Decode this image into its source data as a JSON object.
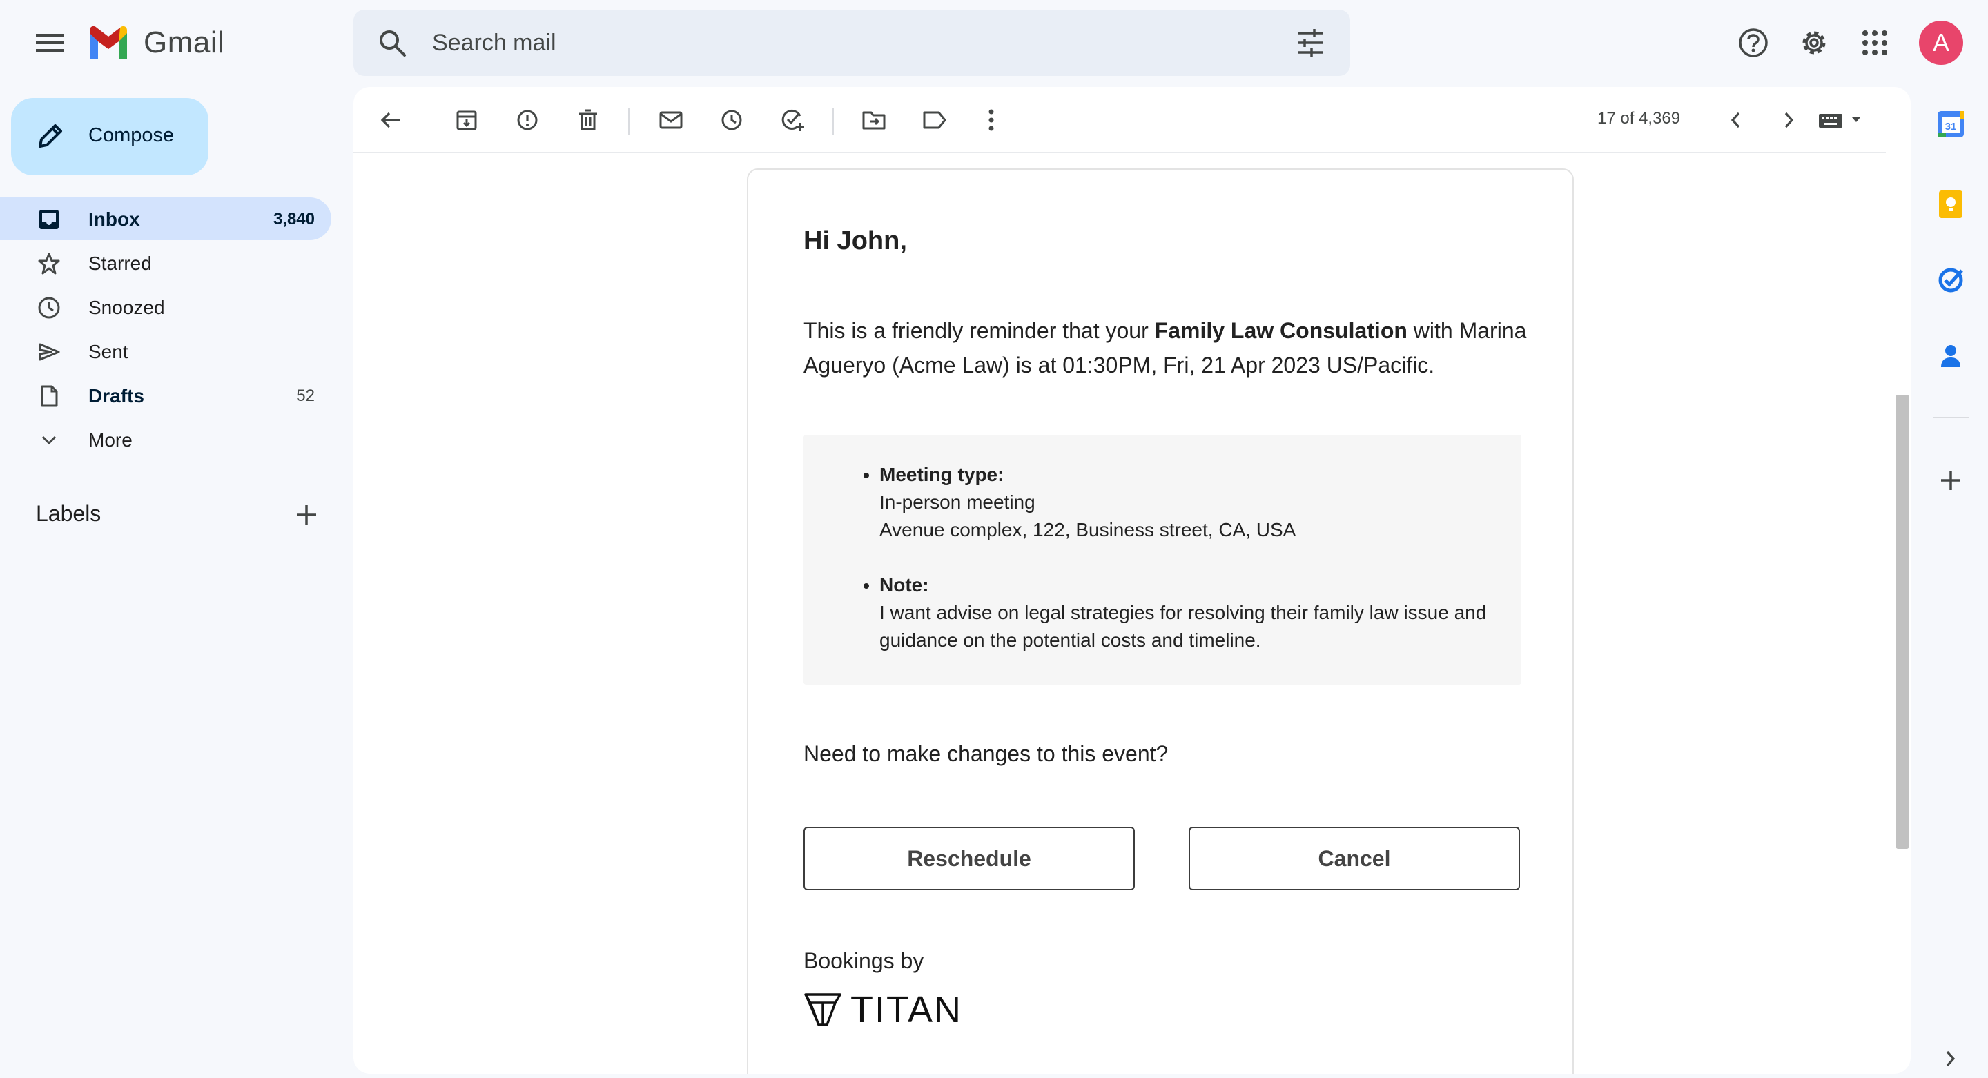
{
  "header": {
    "app_name": "Gmail",
    "search_placeholder": "Search mail",
    "avatar_letter": "A"
  },
  "nav": {
    "compose_label": "Compose",
    "items": [
      {
        "label": "Inbox",
        "count": "3,840",
        "icon": "inbox-icon"
      },
      {
        "label": "Starred",
        "count": "",
        "icon": "star-icon"
      },
      {
        "label": "Snoozed",
        "count": "",
        "icon": "clock-icon"
      },
      {
        "label": "Sent",
        "count": "",
        "icon": "send-icon"
      },
      {
        "label": "Drafts",
        "count": "52",
        "icon": "draft-icon"
      },
      {
        "label": "More",
        "count": "",
        "icon": "chevron-down-icon"
      }
    ],
    "labels_heading": "Labels"
  },
  "toolbar": {
    "pager_text": "17 of 4,369"
  },
  "email": {
    "greeting": "Hi John,",
    "intro_before": "This is a friendly reminder that your ",
    "intro_bold": "Family Law Consulation",
    "intro_after": " with Marina Agueryo (Acme Law) is at 01:30PM, Fri, 21 Apr 2023 US/Pacific.",
    "details": [
      {
        "heading": "Meeting type:",
        "lines": [
          "In-person meeting",
          "Avenue complex, 122, Business street, CA, USA"
        ]
      },
      {
        "heading": "Note:",
        "lines": [
          "I want advise on legal strategies for resolving their family law issue and guidance on the potential costs and timeline."
        ]
      }
    ],
    "question": "Need to make changes to this event?",
    "reschedule_label": "Reschedule",
    "cancel_label": "Cancel",
    "bookings_by": "Bookings by",
    "brand": "TITAN"
  },
  "side_apps": {
    "calendar_day": "31"
  },
  "colors": {
    "accent": "#0b57d0",
    "compose_bg": "#c2e7ff",
    "active_nav_bg": "#d3e3fd",
    "avatar_bg": "#e8456b"
  }
}
